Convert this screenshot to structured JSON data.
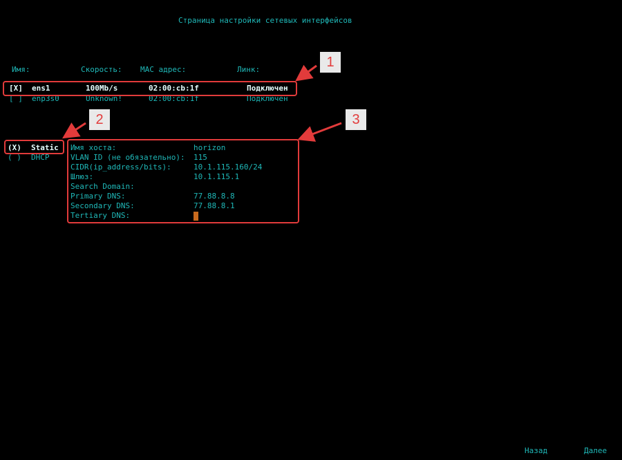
{
  "header": {
    "title": "Страница настройки сетевых интерфейсов"
  },
  "interfaces": {
    "columns": {
      "name": "Имя:",
      "speed": "Скорость:",
      "mac": "MAC адрес:",
      "link": "Линк:"
    },
    "rows": [
      {
        "checkbox": "[X]",
        "name": "ens1",
        "speed": "100Mb/s",
        "mac": "02:00:cb:1f",
        "link": "Подключен"
      },
      {
        "checkbox": "[ ]",
        "name": "enp3s0",
        "speed": "Unknown!",
        "mac": "02:00:cb:1f",
        "link": "Подключен"
      }
    ]
  },
  "mode": {
    "options": [
      {
        "radio": "(X)",
        "label": "Static"
      },
      {
        "radio": "( )",
        "label": "DHCP"
      }
    ]
  },
  "form": {
    "fields": [
      {
        "label": "Имя хоста:",
        "value": "horizon"
      },
      {
        "label": "VLAN ID (не обязательно):",
        "value": "115"
      },
      {
        "label": "CIDR(ip_address/bits):",
        "value": "10.1.115.160/24"
      },
      {
        "label": "Шлюз:",
        "value": "10.1.115.1"
      },
      {
        "label": "Search Domain:",
        "value": ""
      },
      {
        "label": "Primary DNS:",
        "value": "77.88.8.8"
      },
      {
        "label": "Secondary DNS:",
        "value": "77.88.8.1"
      },
      {
        "label": "Tertiary DNS:",
        "value": ""
      }
    ]
  },
  "footer": {
    "back": "Назад",
    "next": "Далее"
  },
  "callouts": [
    "1",
    "2",
    "3"
  ],
  "colors": {
    "text": "#1fb8b8",
    "highlight": "#e8ffff",
    "annotation": "#e23b3b",
    "cursor": "#c86a1e"
  }
}
